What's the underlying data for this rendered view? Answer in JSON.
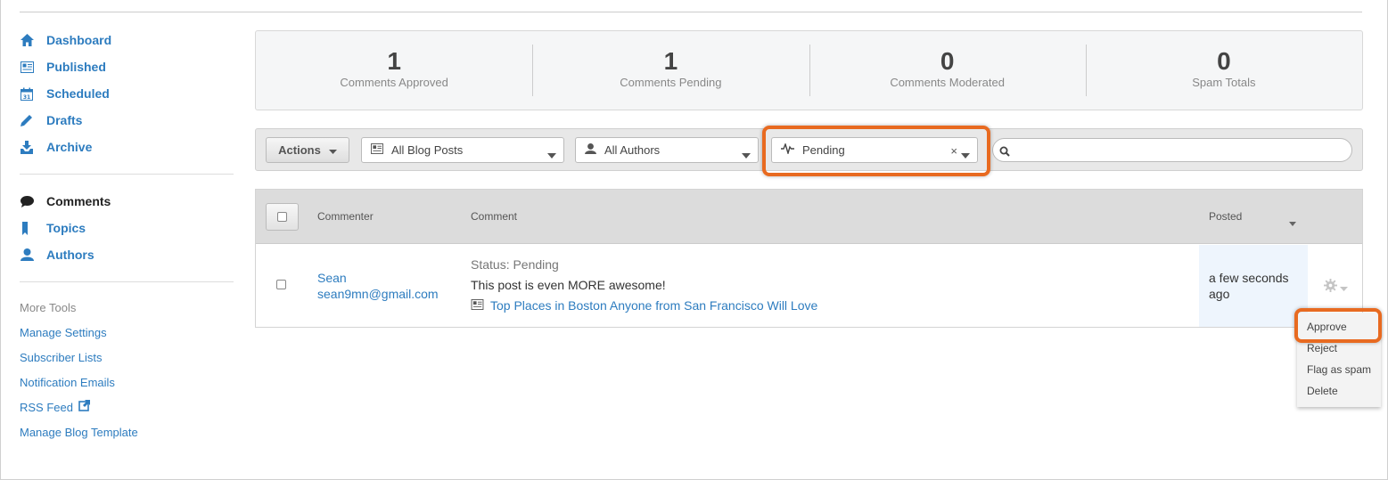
{
  "sidebar": {
    "nav": [
      {
        "label": "Dashboard",
        "icon": "home-icon"
      },
      {
        "label": "Published",
        "icon": "newspaper-icon"
      },
      {
        "label": "Scheduled",
        "icon": "calendar-icon"
      },
      {
        "label": "Drafts",
        "icon": "pencil-icon"
      },
      {
        "label": "Archive",
        "icon": "archive-icon"
      }
    ],
    "nav2": [
      {
        "label": "Comments",
        "icon": "comment-icon"
      },
      {
        "label": "Topics",
        "icon": "bookmark-icon"
      },
      {
        "label": "Authors",
        "icon": "user-icon"
      }
    ],
    "tools_title": "More Tools",
    "tools": [
      {
        "label": "Manage Settings"
      },
      {
        "label": "Subscriber Lists"
      },
      {
        "label": "Notification Emails"
      },
      {
        "label": "RSS Feed"
      },
      {
        "label": "Manage Blog Template"
      }
    ]
  },
  "stats": [
    {
      "value": "1",
      "label": "Comments Approved"
    },
    {
      "value": "1",
      "label": "Comments Pending"
    },
    {
      "value": "0",
      "label": "Comments Moderated"
    },
    {
      "value": "0",
      "label": "Spam Totals"
    }
  ],
  "filters": {
    "actions_label": "Actions",
    "blog_posts": "All Blog Posts",
    "authors": "All Authors",
    "status": "Pending",
    "search_value": ""
  },
  "table": {
    "headers": {
      "commenter": "Commenter",
      "comment": "Comment",
      "posted": "Posted"
    },
    "rows": [
      {
        "name": "Sean",
        "email": "sean9mn@gmail.com",
        "status": "Status: Pending",
        "comment": "This post is even MORE awesome!",
        "post": "Top Places in Boston Anyone from San Francisco Will Love",
        "posted_line1": "a few seconds",
        "posted_line2": "ago"
      }
    ]
  },
  "row_menu": [
    "Approve",
    "Reject",
    "Flag as spam",
    "Delete"
  ],
  "colors": {
    "accent": "#2d7cbf",
    "highlight": "#e86a20"
  }
}
